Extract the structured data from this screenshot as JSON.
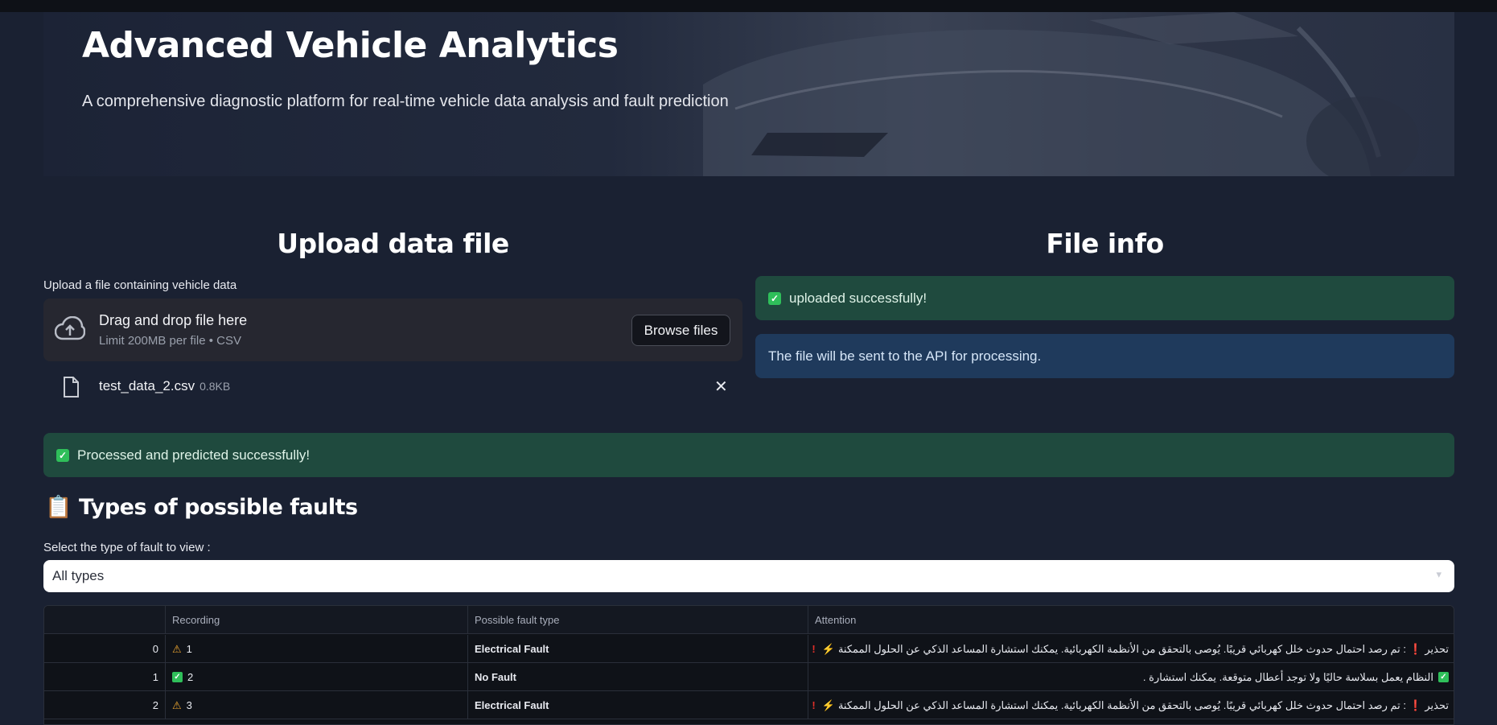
{
  "hero": {
    "title": "Advanced Vehicle Analytics",
    "subtitle": "A comprehensive diagnostic platform for real-time vehicle data analysis and fault prediction"
  },
  "upload": {
    "heading": "Upload data file",
    "label": "Upload a file containing vehicle data",
    "drop_text": "Drag and drop file here",
    "limit_text": "Limit 200MB per file • CSV",
    "browse_label": "Browse files",
    "file_name": "test_data_2.csv",
    "file_size": "0.8KB",
    "close_symbol": "✕"
  },
  "file_info": {
    "heading": "File info",
    "success_text": "uploaded successfully!",
    "info_text": "The file will be sent to the API for processing."
  },
  "processed": {
    "text": "Processed and predicted successfully!"
  },
  "faults": {
    "heading": "📋 Types of possible faults",
    "select_label": "Select the type of fault to view :",
    "select_value": "All types"
  },
  "table": {
    "headers": [
      "",
      "Recording",
      "Possible fault type",
      "Attention"
    ],
    "rows": [
      {
        "index": "0",
        "recording": "1",
        "status": "warn",
        "fault": "Electrical Fault",
        "attention": "تحذير ❗ : تم رصد احتمال حدوث خلل كهربائي قريبًا. يُوصى بالتحقق من الأنظمة الكهربائية. يمكنك استشارة المساعد الذكي عن الحلول الممكنة"
      },
      {
        "index": "1",
        "recording": "2",
        "status": "ok",
        "fault": "No Fault",
        "attention": "النظام يعمل بسلاسة حاليًا ولا توجد أعطال متوقعة. يمكنك استشارة ."
      },
      {
        "index": "2",
        "recording": "3",
        "status": "warn",
        "fault": "Electrical Fault",
        "attention": "تحذير ❗ : تم رصد احتمال حدوث خلل كهربائي قريبًا. يُوصى بالتحقق من الأنظمة الكهربائية. يمكنك استشارة المساعد الذكي عن الحلول الممكنة"
      }
    ]
  },
  "colors": {
    "background": "#1a2132",
    "success_bg": "#1f4a3e",
    "info_bg": "#1f3a5c",
    "check_green": "#2fbf5a",
    "warn_orange": "#f0a830"
  }
}
